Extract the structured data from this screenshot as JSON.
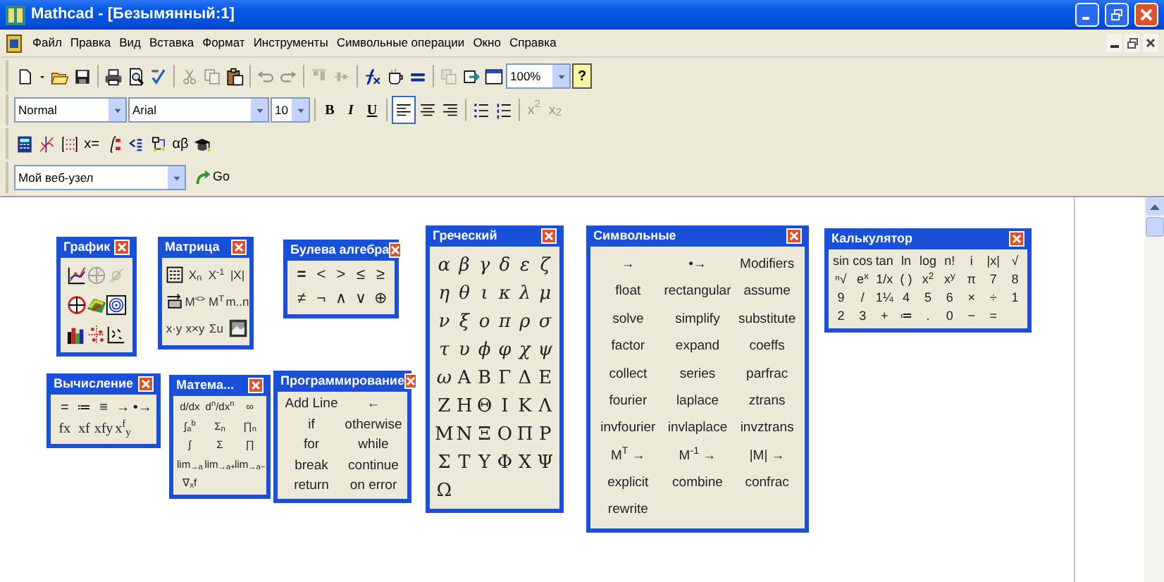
{
  "window": {
    "title": "Mathcad - [Безымянный:1]"
  },
  "menu": [
    "Файл",
    "Правка",
    "Вид",
    "Вставка",
    "Формат",
    "Инструменты",
    "Символьные операции",
    "Окно",
    "Справка"
  ],
  "standard_toolbar": [
    {
      "kind": "button",
      "disabled": false
    },
    {
      "kind": "dropdown",
      "disabled": false
    },
    {
      "kind": "button",
      "disabled": false
    },
    {
      "kind": "button",
      "disabled": false
    },
    {
      "kind": "separator"
    },
    {
      "kind": "button",
      "disabled": false
    },
    {
      "kind": "button",
      "disabled": false
    },
    {
      "kind": "button",
      "disabled": false
    },
    {
      "kind": "separator"
    },
    {
      "kind": "button",
      "disabled": true
    },
    {
      "kind": "button",
      "disabled": true
    },
    {
      "kind": "button",
      "disabled": false
    },
    {
      "kind": "separator"
    },
    {
      "kind": "button",
      "disabled": true
    },
    {
      "kind": "button",
      "disabled": true
    },
    {
      "kind": "separator"
    },
    {
      "kind": "button",
      "disabled": true
    },
    {
      "kind": "button",
      "disabled": true
    },
    {
      "kind": "separator"
    },
    {
      "kind": "button",
      "disabled": false
    },
    {
      "kind": "button",
      "disabled": false
    },
    {
      "kind": "button",
      "disabled": false
    },
    {
      "kind": "separator"
    },
    {
      "kind": "button",
      "disabled": true
    },
    {
      "kind": "button",
      "disabled": false
    },
    {
      "kind": "button",
      "disabled": false
    },
    {
      "kind": "combo",
      "value": "100%"
    },
    {
      "kind": "text",
      "label": "?",
      "disabled": false
    }
  ],
  "formatting_toolbar": [
    {
      "kind": "combo",
      "value": "Normal"
    },
    {
      "kind": "combo",
      "value": "Arial"
    },
    {
      "kind": "combo",
      "value": "10"
    },
    {
      "kind": "separator"
    },
    {
      "kind": "text",
      "label": "B",
      "disabled": false
    },
    {
      "kind": "text",
      "label": "I",
      "disabled": false
    },
    {
      "kind": "text",
      "label": "U",
      "disabled": false
    },
    {
      "kind": "separator"
    },
    {
      "kind": "button",
      "selected": true
    },
    {
      "kind": "button",
      "selected": false
    },
    {
      "kind": "button",
      "selected": false
    },
    {
      "kind": "separator"
    },
    {
      "kind": "button",
      "disabled": false
    },
    {
      "kind": "button",
      "disabled": false
    },
    {
      "kind": "separator"
    },
    {
      "kind": "text",
      "label": "x$^{2}$",
      "disabled": true
    },
    {
      "kind": "text",
      "label": "x$_{2}$",
      "disabled": true
    }
  ],
  "math_toolbar": [
    {
      "kind": "button"
    },
    {
      "kind": "button"
    },
    {
      "kind": "button"
    },
    {
      "kind": "text",
      "label": "x="
    },
    {
      "kind": "button"
    },
    {
      "kind": "button"
    },
    {
      "kind": "button"
    },
    {
      "kind": "text",
      "label": "αβ"
    },
    {
      "kind": "button"
    }
  ],
  "web_toolbar": {
    "address": "Мой веб-узел",
    "go": "Go"
  },
  "palettes": [
    {
      "kind": "graph",
      "title": "График",
      "buttons": [
        {
          "disabled": false
        },
        {
          "disabled": true
        },
        {
          "disabled": true
        },
        {
          "disabled": false
        },
        {
          "disabled": false
        },
        {
          "disabled": false
        },
        {
          "disabled": false
        },
        {
          "disabled": false
        },
        {
          "disabled": false
        }
      ]
    },
    {
      "kind": "matrix",
      "title": "Матрица",
      "buttons": [
        {
          "kind": "icon"
        },
        {
          "kind": "text",
          "label": "X$_{n}$"
        },
        {
          "kind": "text",
          "label": "X$^{-1}$"
        },
        {
          "kind": "text",
          "label": "|X|"
        },
        {
          "kind": "icon"
        },
        {
          "kind": "text",
          "label": "M$^{<>}$"
        },
        {
          "kind": "text",
          "label": "M$^{T}$"
        },
        {
          "kind": "text",
          "label": "m..n"
        },
        {
          "kind": "text",
          "label": "x·y"
        },
        {
          "kind": "text",
          "label": "x×y"
        },
        {
          "kind": "text",
          "label": "Σu"
        },
        {
          "kind": "icon"
        }
      ]
    },
    {
      "kind": "text",
      "title": "Булева алгебра",
      "buttons": [
        "=",
        "<",
        ">",
        "≤",
        "≥",
        "≠",
        "¬",
        "∧",
        "∨",
        "⊕"
      ]
    },
    {
      "kind": "text",
      "title": "Вычисление",
      "buttons": [
        "=",
        "≔",
        "≡",
        "→",
        "•→",
        "fx",
        "xf",
        "xfy",
        "x$^{f}$$_{y}$"
      ]
    },
    {
      "kind": "text",
      "title": "Матема...",
      "buttons": [
        "d/dx",
        "d$^{n}$/dx$^{n}$",
        "∞",
        "∫$_{a}$$^{b}$",
        "Σ$_{n}$",
        "∏$_{n}$",
        "∫",
        "Σ",
        "∏",
        "lim$_{→a}$",
        "lim$_{→a+}$",
        "lim$_{→a−}$",
        "∇$_{x}$f"
      ]
    },
    {
      "kind": "text",
      "title": "Программирование",
      "buttons": [
        "Add Line",
        "←",
        "if",
        "otherwise",
        "for",
        "while",
        "break",
        "continue",
        "return",
        "on error"
      ]
    },
    {
      "kind": "text",
      "title": "Греческий",
      "buttons": [
        "α",
        "β",
        "γ",
        "δ",
        "ε",
        "ζ",
        "η",
        "θ",
        "ι",
        "κ",
        "λ",
        "μ",
        "ν",
        "ξ",
        "ο",
        "π",
        "ρ",
        "σ",
        "τ",
        "υ",
        "ϕ",
        "φ",
        "χ",
        "ψ",
        "ω",
        "Α",
        "Β",
        "Γ",
        "Δ",
        "Ε",
        "Ζ",
        "Η",
        "Θ",
        "Ι",
        "Κ",
        "Λ",
        "Μ",
        "Ν",
        "Ξ",
        "Ο",
        "Π",
        "Ρ",
        "Σ",
        "Τ",
        "Υ",
        "Φ",
        "Χ",
        "Ψ",
        "Ω"
      ]
    },
    {
      "kind": "text",
      "title": "Символьные",
      "buttons": [
        "→",
        "•→",
        "Modifiers",
        "float",
        "rectangular",
        "assume",
        "solve",
        "simplify",
        "substitute",
        "factor",
        "expand",
        "coeffs",
        "collect",
        "series",
        "parfrac",
        "fourier",
        "laplace",
        "ztrans",
        "invfourier",
        "invlaplace",
        "invztrans",
        "M$^{T}$ →",
        "M$^{-1}$ →",
        "|M| →",
        "explicit",
        "combine",
        "confrac",
        "rewrite"
      ]
    },
    {
      "kind": "text",
      "title": "Калькулятор",
      "buttons": [
        "sin",
        "cos",
        "tan",
        "ln",
        "log",
        "n!",
        "i",
        "|x|",
        "√",
        "ⁿ√",
        "e$^{x}$",
        "1/x",
        "( )",
        "x$^{2}$",
        "x$^{y}$",
        "π",
        "7",
        "8",
        "9",
        "/",
        "1¼",
        "4",
        "5",
        "6",
        "×",
        "÷",
        "1",
        "2",
        "3",
        "+",
        "≔",
        ".",
        "0",
        "−",
        "="
      ]
    }
  ]
}
